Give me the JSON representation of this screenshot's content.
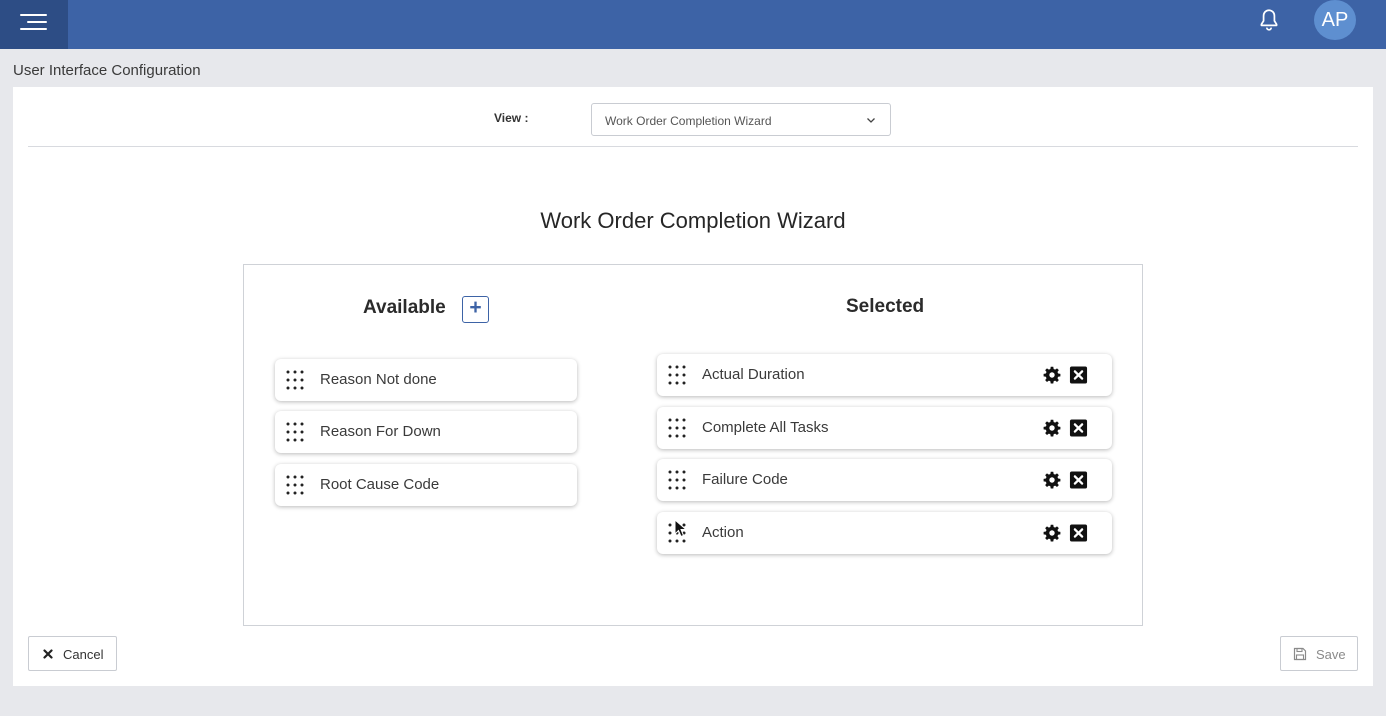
{
  "header": {
    "avatar_initials": "AP",
    "icons": {
      "menu": "hamburger-menu-icon",
      "notifications": "bell-icon"
    }
  },
  "page": {
    "title": "User Interface Configuration"
  },
  "view_selector": {
    "label": "View :",
    "selected": "Work Order Completion Wizard"
  },
  "wizard": {
    "title": "Work Order Completion Wizard",
    "available_header": "Available",
    "selected_header": "Selected",
    "add_symbol": "+",
    "available_items": [
      {
        "label": "Reason Not done"
      },
      {
        "label": "Reason For Down"
      },
      {
        "label": "Root Cause Code"
      }
    ],
    "selected_items": [
      {
        "label": "Actual Duration"
      },
      {
        "label": "Complete All Tasks"
      },
      {
        "label": "Failure Code"
      },
      {
        "label": "Action"
      }
    ]
  },
  "footer": {
    "cancel_label": "Cancel",
    "save_label": "Save"
  },
  "colors": {
    "topbar": "#3d63a6",
    "menu_button": "#2d4d85",
    "avatar": "#5e8fd0",
    "accent": "#3d63a6"
  }
}
